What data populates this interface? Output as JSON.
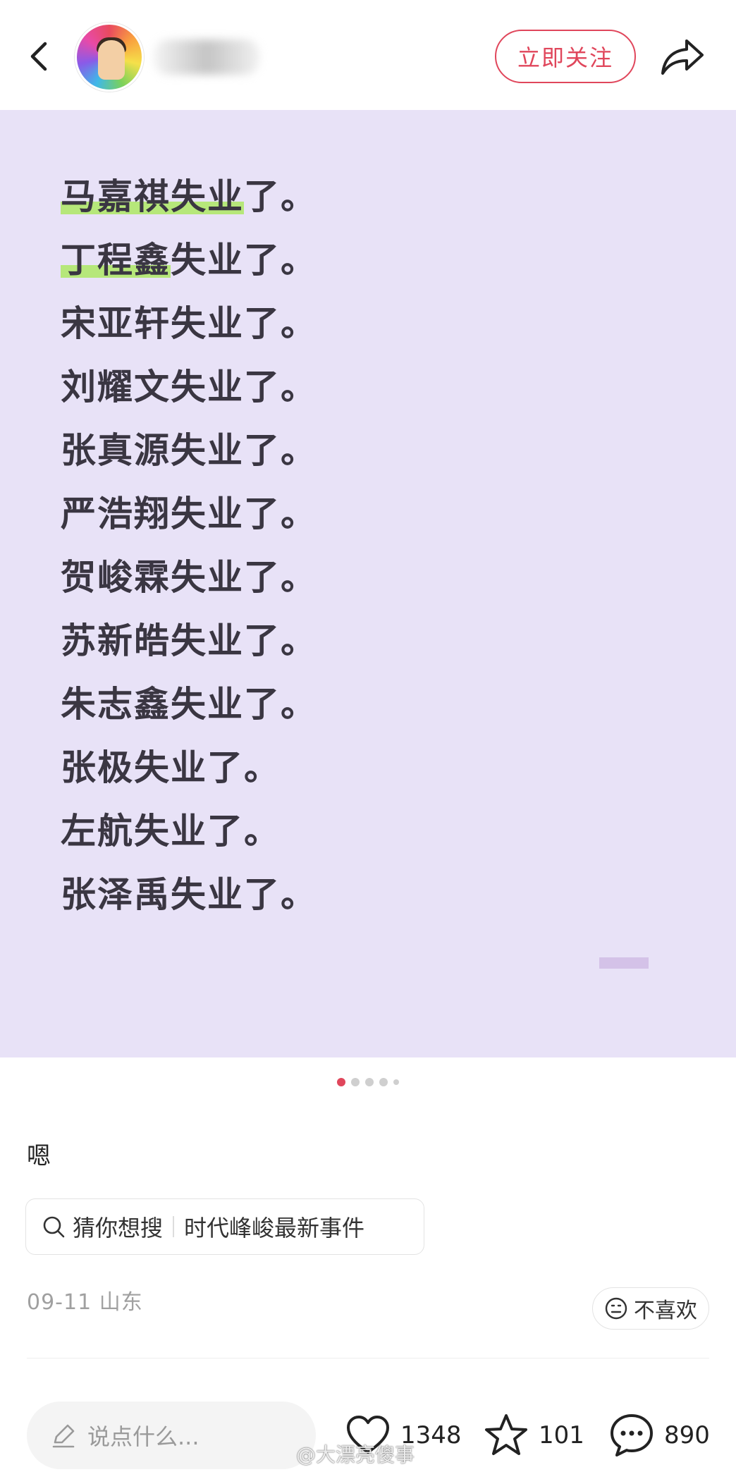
{
  "header": {
    "follow_label": "立即关注"
  },
  "image": {
    "lines": [
      {
        "highlight": "马嘉祺",
        "rest": "失业了。",
        "extra_highlight": "失业"
      },
      {
        "highlight": "丁程鑫",
        "rest": "失业了。",
        "extra_highlight": ""
      },
      {
        "highlight": "",
        "rest": "宋亚轩失业了。",
        "extra_highlight": ""
      },
      {
        "highlight": "",
        "rest": "刘耀文失业了。",
        "extra_highlight": ""
      },
      {
        "highlight": "",
        "rest": "张真源失业了。",
        "extra_highlight": ""
      },
      {
        "highlight": "",
        "rest": "严浩翔失业了。",
        "extra_highlight": ""
      },
      {
        "highlight": "",
        "rest": "贺峻霖失业了。",
        "extra_highlight": ""
      },
      {
        "highlight": "",
        "rest": "苏新皓失业了。",
        "extra_highlight": ""
      },
      {
        "highlight": "",
        "rest": "朱志鑫失业了。",
        "extra_highlight": ""
      },
      {
        "highlight": "",
        "rest": "张极失业了。",
        "extra_highlight": ""
      },
      {
        "highlight": "",
        "rest": "左航失业了。",
        "extra_highlight": ""
      },
      {
        "highlight": "",
        "rest": "张泽禹失业了。",
        "extra_highlight": ""
      }
    ]
  },
  "pager": {
    "count": 5,
    "active_index": 0
  },
  "post": {
    "caption": "嗯",
    "search_label": "猜你想搜",
    "search_topic": "时代峰峻最新事件",
    "meta": "09-11 山东",
    "dislike_label": "不喜欢"
  },
  "bottom_bar": {
    "comment_placeholder": "说点什么...",
    "likes": "1348",
    "stars": "101",
    "comments": "890"
  },
  "watermark": "@大漂亮傻事",
  "colors": {
    "accent": "#e0465b",
    "panel_bg": "#e8e2f7",
    "highlight": "#b6e77a"
  }
}
